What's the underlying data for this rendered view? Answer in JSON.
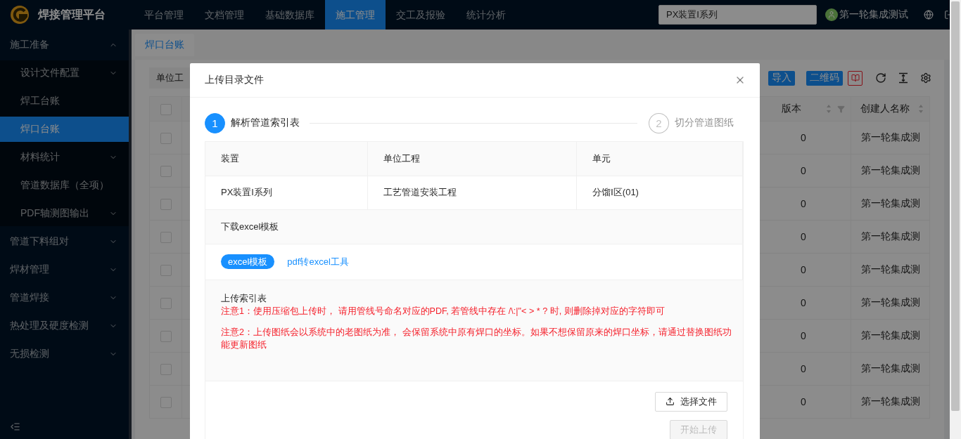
{
  "app": {
    "title": "焊接管理平台"
  },
  "nav": [
    {
      "label": "平台管理",
      "selected": false
    },
    {
      "label": "文档管理",
      "selected": false
    },
    {
      "label": "基础数据库",
      "selected": false
    },
    {
      "label": "施工管理",
      "selected": true
    },
    {
      "label": "交工及报验",
      "selected": false
    },
    {
      "label": "统计分析",
      "selected": false
    }
  ],
  "search": {
    "value": "PX装置I系列"
  },
  "user": {
    "name": "第一轮集成测试"
  },
  "sidebar": {
    "items": [
      {
        "label": "施工准备",
        "expanded": true,
        "selected": false,
        "children": [
          {
            "label": "设计文件配置",
            "expanded": false,
            "selected": false
          },
          {
            "label": "焊工台账",
            "selected": false
          },
          {
            "label": "焊口台账",
            "selected": true
          },
          {
            "label": "材料统计",
            "expanded": false,
            "selected": false
          },
          {
            "label": "管道数据库（全项）",
            "selected": false
          },
          {
            "label": "PDF轴测图输出",
            "expanded": false,
            "selected": false
          }
        ]
      },
      {
        "label": "管道下料组对",
        "expanded": false,
        "selected": false
      },
      {
        "label": "焊材管理",
        "expanded": false,
        "selected": false
      },
      {
        "label": "管道焊接",
        "expanded": false,
        "selected": false
      },
      {
        "label": "热处理及硬度检测",
        "expanded": false,
        "selected": false
      },
      {
        "label": "无损检测",
        "expanded": false,
        "selected": false
      }
    ]
  },
  "page_tabs": [
    {
      "label": "焊口台账",
      "selected": true
    }
  ],
  "toolbar": {
    "filter": "单位工",
    "buttons": [
      {
        "label": "导入"
      },
      {
        "label": "二维码"
      }
    ]
  },
  "table": {
    "select_all": {
      "checked": false
    },
    "columns": [
      {
        "label": "版本",
        "sortable": true,
        "filterable": true
      },
      {
        "label": "创建人名称",
        "sortable": true,
        "filterable": false
      }
    ],
    "rows": [
      {
        "checked": false,
        "cells": [
          "0",
          "第一轮集成测"
        ]
      },
      {
        "checked": false,
        "cells": [
          "0",
          "第一轮集成测"
        ]
      },
      {
        "checked": false,
        "cells": [
          "0",
          "第一轮集成测"
        ]
      },
      {
        "checked": false,
        "cells": [
          "0",
          "第一轮集成测"
        ]
      },
      {
        "checked": false,
        "cells": [
          "0",
          "第一轮集成测"
        ]
      },
      {
        "checked": false,
        "cells": [
          "0",
          "第一轮集成测"
        ]
      },
      {
        "checked": false,
        "cells": [
          "0",
          "第一轮集成测"
        ]
      },
      {
        "checked": false,
        "cells": [
          "0",
          "第一轮集成测"
        ]
      },
      {
        "checked": false,
        "cells": [
          "0",
          "第一轮集成测"
        ]
      }
    ]
  },
  "dialog": {
    "title": "上传目录文件",
    "steps": [
      {
        "number": "1",
        "label": "解析管道索引表",
        "selected": true
      },
      {
        "number": "2",
        "label": "切分管道图纸",
        "selected": false
      }
    ],
    "info": {
      "headers": [
        "装置",
        "单位工程",
        "单元"
      ],
      "values": [
        "PX装置I系列",
        "工艺管道安装工程",
        "分馏Ⅰ区(01)"
      ]
    },
    "template_section": {
      "title": "下载excel模板",
      "button": "excel模板",
      "link": "pdf转excel工具"
    },
    "upload_section": {
      "title": "上传索引表",
      "notes": [
        "注意1：使用压缩包上传时， 请用管线号命名对应的PDF, 若管线中存在 /\\:|\"< > * ? 时, 则删除掉对应的字符即可",
        "注意2：上传图纸会以系统中的老图纸为准， 会保留系统中原有焊口的坐标。如果不想保留原来的焊口坐标，请通过替换图纸功能更新图纸"
      ]
    },
    "actions": [
      {
        "label": "选择文件",
        "kind": "select",
        "disabled": false
      },
      {
        "label": "开始上传",
        "kind": "start",
        "disabled": true
      }
    ]
  }
}
